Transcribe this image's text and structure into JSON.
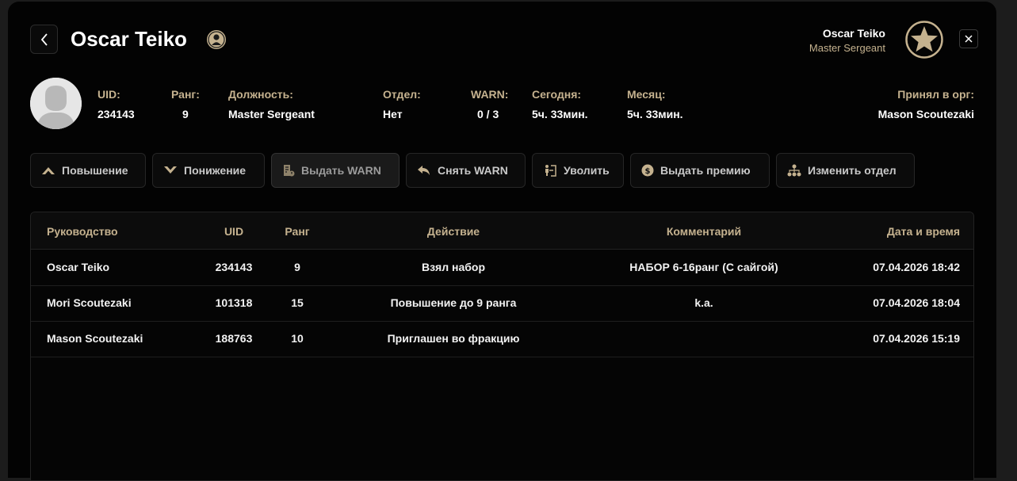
{
  "header": {
    "title": "Oscar Teiko",
    "user_name": "Oscar Teiko",
    "user_rank": "Master Sergeant"
  },
  "profile": {
    "uid_label": "UID:",
    "uid": "234143",
    "rank_label": "Ранг:",
    "rank": "9",
    "position_label": "Должность:",
    "position": "Master Sergeant",
    "department_label": "Отдел:",
    "department": "Нет",
    "warn_label": "WARN:",
    "warn": "0 / 3",
    "today_label": "Сегодня:",
    "today": "5ч. 33мин.",
    "month_label": "Месяц:",
    "month": "5ч. 33мин.",
    "accepted_label": "Принял в орг:",
    "accepted": "Mason Scoutezaki"
  },
  "actions": {
    "promote": "Повышение",
    "demote": "Понижение",
    "give_warn": "Выдать WARN",
    "remove_warn": "Снять WARN",
    "dismiss": "Уволить",
    "bonus": "Выдать премию",
    "change_dept": "Изменить отдел"
  },
  "table": {
    "headers": {
      "leader": "Руководство",
      "uid": "UID",
      "rank": "Ранг",
      "action": "Действие",
      "comment": "Комментарий",
      "datetime": "Дата и время"
    },
    "rows": [
      {
        "leader": "Oscar Teiko",
        "uid": "234143",
        "rank": "9",
        "action": "Взял набор",
        "comment": "НАБОР 6-16ранг (С сайгой)",
        "datetime": "07.04.2026 18:42"
      },
      {
        "leader": "Mori Scoutezaki",
        "uid": "101318",
        "rank": "15",
        "action": "Повышение до 9 ранга",
        "comment": "k.a.",
        "datetime": "07.04.2026 18:04"
      },
      {
        "leader": "Mason Scoutezaki",
        "uid": "188763",
        "rank": "10",
        "action": "Приглашен во фракцию",
        "comment": "",
        "datetime": "07.04.2026 15:19"
      }
    ]
  },
  "colors": {
    "accent": "#c5b28f",
    "background": "#030303"
  }
}
